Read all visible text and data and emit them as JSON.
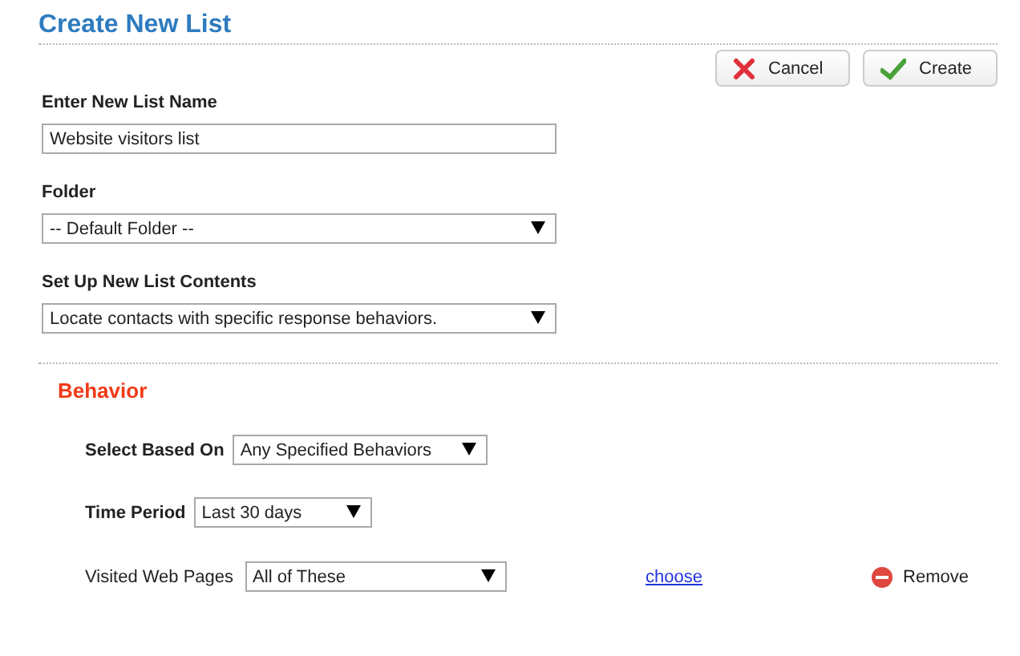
{
  "title": "Create New List",
  "buttons": [
    {
      "kind": "cancel",
      "label": "Cancel"
    },
    {
      "kind": "create",
      "label": "Create"
    }
  ],
  "fields": [
    {
      "kind": "text",
      "label": "Enter New List Name",
      "value": "Website visitors list"
    },
    {
      "kind": "select",
      "label": "Folder",
      "value": "-- Default Folder --"
    },
    {
      "kind": "select",
      "label": "Set Up New List Contents",
      "value": "Locate contacts with specific response behaviors."
    }
  ],
  "behavior": {
    "heading": "Behavior",
    "rows": [
      {
        "label": "Select Based On",
        "value": "Any Specified Behaviors",
        "bold": true
      },
      {
        "label": "Time Period",
        "value": "Last 30 days",
        "bold": true
      }
    ],
    "criterion": {
      "label": "Visited Web Pages",
      "value": "All of These",
      "link": "choose",
      "remove": "Remove"
    }
  }
}
